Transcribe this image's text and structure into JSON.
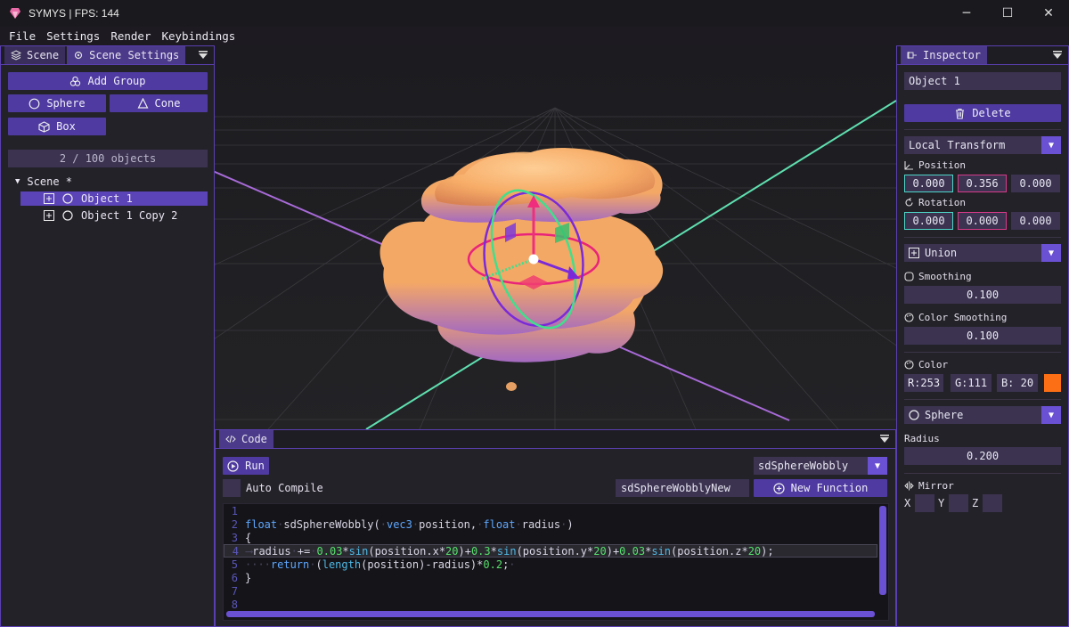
{
  "window": {
    "title": "SYMYS | FPS: 144"
  },
  "menu": [
    "File",
    "Settings",
    "Render",
    "Keybindings"
  ],
  "left_panel": {
    "tabs": [
      "Scene",
      "Scene Settings"
    ],
    "buttons": {
      "add_group": "Add Group",
      "sphere": "Sphere",
      "cone": "Cone",
      "box": "Box"
    },
    "object_count": "2 / 100 objects",
    "tree": {
      "root": "Scene *",
      "items": [
        "Object 1",
        "Object 1 Copy 2"
      ]
    }
  },
  "code_panel": {
    "tab": "Code",
    "run": "Run",
    "auto_compile": "Auto Compile",
    "function_select": "sdSphereWobbly",
    "new_function_name": "sdSphereWobblyNew",
    "new_function_button": "New Function",
    "line_numbers": [
      "1",
      "2",
      "3",
      "4",
      "5",
      "6",
      "7",
      "8"
    ]
  },
  "inspector": {
    "tab": "Inspector",
    "object_name": "Object 1",
    "delete": "Delete",
    "transform_mode": "Local Transform",
    "position_label": "Position",
    "position": [
      "0.000",
      "0.356",
      "0.000"
    ],
    "rotation_label": "Rotation",
    "rotation": [
      "0.000",
      "0.000",
      "0.000"
    ],
    "operation": "Union",
    "smoothing_label": "Smoothing",
    "smoothing": "0.100",
    "color_smoothing_label": "Color Smoothing",
    "color_smoothing": "0.100",
    "color_label": "Color",
    "color": {
      "r": "R:253",
      "g": "G:111",
      "b": "B: 20",
      "swatch": "#fd6f14"
    },
    "shape": "Sphere",
    "radius_label": "Radius",
    "radius": "0.200",
    "mirror_label": "Mirror",
    "mirror_axes": [
      "X",
      "Y",
      "Z"
    ]
  },
  "colors": {
    "accent": "#4e3aa0",
    "border": "#5a3fb0",
    "object": "#f8b06a"
  }
}
